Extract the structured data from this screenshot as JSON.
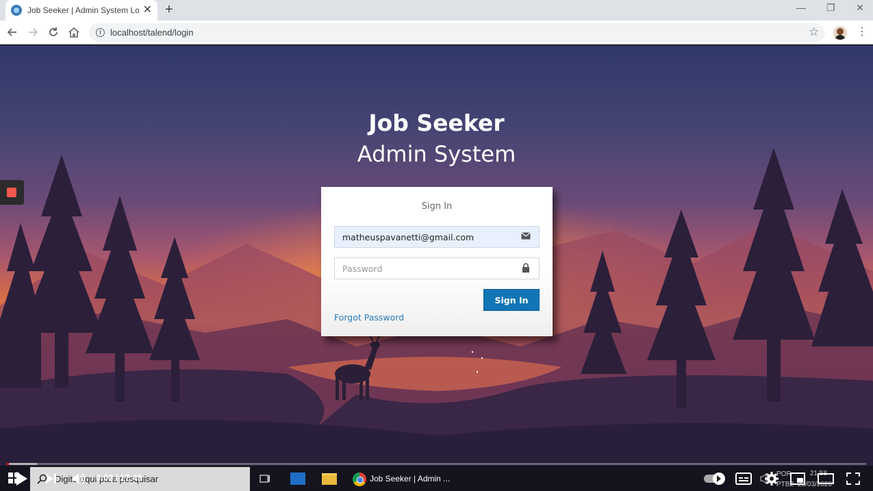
{
  "browser": {
    "tab_title": "Job Seeker | Admin System Log",
    "url": "localhost/talend/login"
  },
  "page": {
    "title": "Job Seeker",
    "subtitle": "Admin System",
    "login": {
      "heading": "Sign In",
      "email_value": "matheuspavanetti@gmail.com",
      "password_placeholder": "Password",
      "submit_label": "Sign In",
      "forgot_label": "Forgot Password"
    }
  },
  "player": {
    "time": "0:02 / 17:49",
    "progress": 0.002
  },
  "taskbar": {
    "search_placeholder": "Digite aqui para pesquisar",
    "active_task": "Job Seeker | Admin ...",
    "tray_lang": "POR",
    "tray_layout": "PTB2",
    "tray_time": "21:58",
    "tray_date": "23/03/2020"
  },
  "colors": {
    "primary_button": "#1275b6",
    "link": "#2a7ab8",
    "autofill": "#e8f0fe",
    "record": "#f0584e"
  }
}
